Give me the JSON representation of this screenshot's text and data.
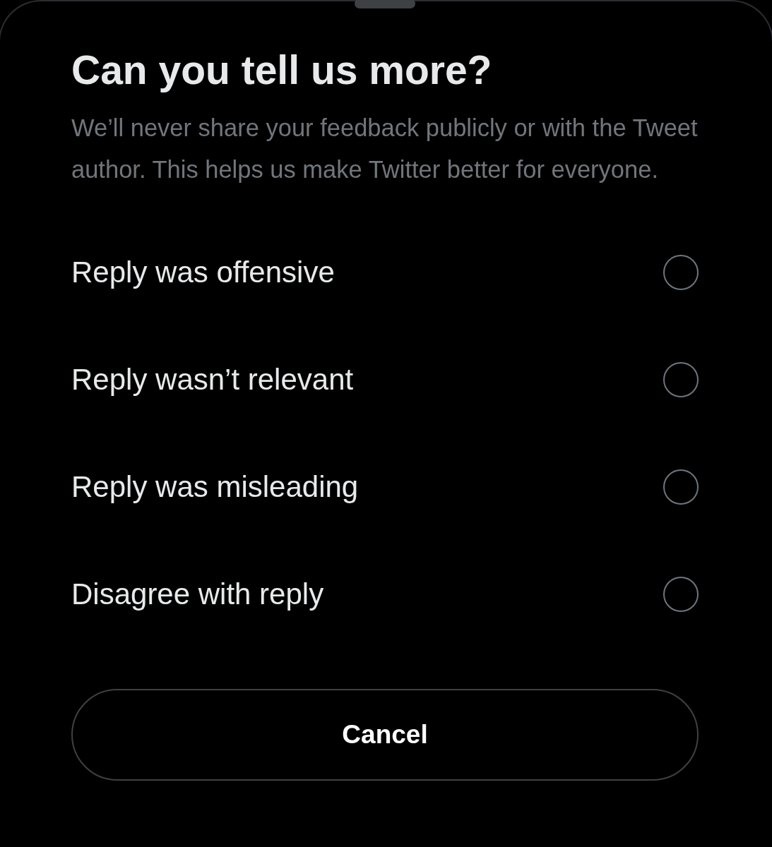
{
  "title": "Can you tell us more?",
  "description": "We’ll never share your feedback publicly or with the Tweet author. This helps us make Twitter better for everyone.",
  "options": [
    {
      "label": "Reply was offensive",
      "selected": false
    },
    {
      "label": "Reply wasn’t relevant",
      "selected": false
    },
    {
      "label": "Reply was misleading",
      "selected": false
    },
    {
      "label": "Disagree with reply",
      "selected": false
    }
  ],
  "buttons": [
    {
      "label": "Cancel"
    }
  ]
}
